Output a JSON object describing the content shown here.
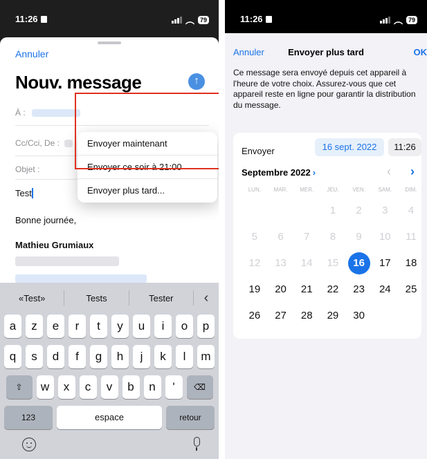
{
  "left_screen": {
    "status": {
      "time": "11:26",
      "battery": "79"
    },
    "cancel_label": "Annuler",
    "title": "Nouv. message",
    "fields": {
      "to_label": "À :",
      "cc_label": "Cc/Cci, De :",
      "subject_label": "Objet :"
    },
    "subject_value": "Test",
    "body_greeting": "Bonne journée,",
    "signature_name": "Mathieu Grumiaux",
    "send_menu": [
      "Envoyer maintenant",
      "Envoyer ce soir à 21:00",
      "Envoyer plus tard..."
    ],
    "keyboard": {
      "suggestions": [
        "«Test»",
        "Tests",
        "Tester"
      ],
      "row1": [
        "a",
        "z",
        "e",
        "r",
        "t",
        "y",
        "u",
        "i",
        "o",
        "p"
      ],
      "row2": [
        "q",
        "s",
        "d",
        "f",
        "g",
        "h",
        "j",
        "k",
        "l",
        "m"
      ],
      "row3": [
        "w",
        "x",
        "c",
        "v",
        "b",
        "n",
        "'"
      ],
      "numbers_label": "123",
      "space_label": "espace",
      "return_label": "retour"
    }
  },
  "right_screen": {
    "status": {
      "time": "11:26",
      "battery": "79"
    },
    "cancel_label": "Annuler",
    "title": "Envoyer plus tard",
    "ok_label": "OK",
    "info_text": "Ce message sera envoyé depuis cet appareil à l'heure de votre choix. Assurez-vous que cet appareil reste en ligne pour garantir la distribution du message.",
    "send_label": "Envoyer",
    "date_value": "16 sept. 2022",
    "time_value": "11:26",
    "month_label": "Septembre 2022",
    "weekdays": [
      "LUN.",
      "MAR.",
      "MER.",
      "JEU.",
      "VEN.",
      "SAM.",
      "DIM."
    ],
    "weeks": [
      [
        "",
        "",
        "",
        "1",
        "2",
        "3",
        "4"
      ],
      [
        "5",
        "6",
        "7",
        "8",
        "9",
        "10",
        "11"
      ],
      [
        "12",
        "13",
        "14",
        "15",
        "16",
        "17",
        "18"
      ],
      [
        "19",
        "20",
        "21",
        "22",
        "23",
        "24",
        "25"
      ],
      [
        "26",
        "27",
        "28",
        "29",
        "30",
        "",
        ""
      ]
    ],
    "selected_day": "16",
    "last_past_day": 15
  },
  "colors": {
    "accent": "#1a73e8",
    "highlight_box": "#e0301e"
  }
}
